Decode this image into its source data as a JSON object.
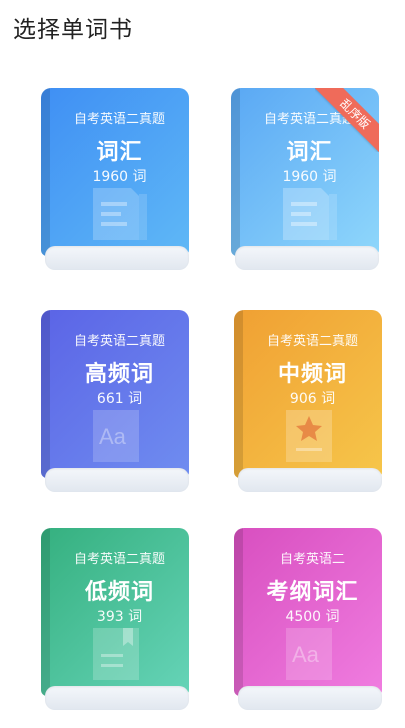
{
  "header": {
    "title": "选择单词书"
  },
  "books": [
    {
      "subtitle": "自考英语二真题",
      "name": "词汇",
      "count": "1960 词",
      "icon": "document-icon"
    },
    {
      "subtitle": "自考英语二真题",
      "name": "词汇",
      "count": "1960 词",
      "icon": "document-icon",
      "badge": "乱序版",
      "badge_color": "#ef6b5a"
    },
    {
      "subtitle": "自考英语二真题",
      "name": "高频词",
      "count": "661 词",
      "icon": "aa-icon"
    },
    {
      "subtitle": "自考英语二真题",
      "name": "中频词",
      "count": "906 词",
      "icon": "star-icon"
    },
    {
      "subtitle": "自考英语二真题",
      "name": "低频词",
      "count": "393 词",
      "icon": "bookmark-icon"
    },
    {
      "subtitle": "自考英语二",
      "name": "考纲词汇",
      "count": "4500 词",
      "icon": "aa-icon"
    }
  ]
}
